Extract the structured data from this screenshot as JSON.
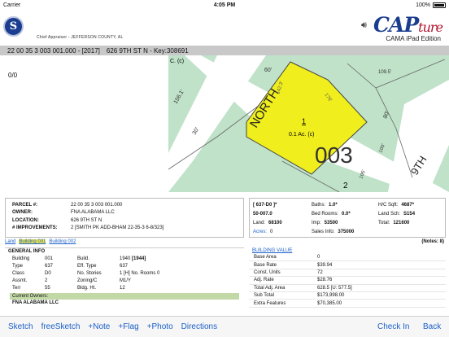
{
  "status": {
    "carrier": "Carrier",
    "time": "4:05 PM",
    "battery": "100%"
  },
  "header": {
    "logo_letter": "S",
    "appraiser": "Chief Appraiser - JEFFERSON COUNTY, AL",
    "brand_main": "CAP",
    "brand_script": "ture",
    "edition": "CAMA iPad Edition"
  },
  "titlebar": {
    "parcel_year": "22 00 35 3 003 001.000 - [2017]",
    "address_key": "626 9TH ST N - Key:308691"
  },
  "nav_count": "0/0",
  "map": {
    "labels": {
      "corner_c": "C. (c)",
      "north": "NORTH",
      "ninth": "9TH",
      "block": "003",
      "lot": "1",
      "acreage": "0.1 Ac. (c)",
      "lot2": "2",
      "d156": "156.1'",
      "d30": "30'",
      "d60": "60'",
      "d142": "142.3'",
      "d176": "176'",
      "d80": "80'",
      "d109": "109.5'",
      "d105": "105'",
      "d100": "100'"
    }
  },
  "parcel": {
    "rows": [
      {
        "key": "PARCEL #:",
        "value": "22 00 35 3 003 001.000"
      },
      {
        "key": "OWNER:",
        "value": "FNA ALABAMA LLC"
      },
      {
        "key": "LOCATION:",
        "value": "626 9TH ST N"
      },
      {
        "key": "# IMPROVEMENTS:",
        "value": "2 [SMITH PK ADD-BHAM 22-35-3 6-8/323]"
      }
    ]
  },
  "values": {
    "code": "[ 637-D0 ]*",
    "baths_label": "Baths:",
    "baths": "1.0*",
    "hc_label": "H/C Sqft:",
    "hc": "4687*",
    "zone": "50-007.0",
    "bed_label": "Bed Rooms:",
    "bed": "0.0*",
    "sch_label": "Land Sch:",
    "sch": "S154",
    "land_label": "Land:",
    "land": "68100",
    "imp_label": "Imp:",
    "imp": "53500",
    "total_label": "Total:",
    "total": "121600",
    "acres_label": "Acres:",
    "acres": "0",
    "sales_label": "Sales Info:",
    "sales": "375000"
  },
  "tabs": {
    "land": "Land",
    "b1": "Building 001",
    "b2": "Building 002",
    "notes": "(Notes: 8)"
  },
  "general": {
    "title": "GENERAL INFO",
    "rows": [
      {
        "a": "Building",
        "b": "001",
        "c": "Build.",
        "d": "1940",
        "e": "[1944]"
      },
      {
        "a": "Type",
        "b": "637",
        "c": "Eff. Type",
        "d": "637",
        "e": ""
      },
      {
        "a": "Class",
        "b": "D0",
        "c": "No. Stories",
        "d": "1 [H] No. Rooms 0",
        "e": ""
      },
      {
        "a": "Assmt.",
        "b": "2",
        "c": "Zoning/C",
        "d": "M1/Y",
        "e": ""
      },
      {
        "a": "Terr",
        "b": "55",
        "c": "Bldg. Ht.",
        "d": "12",
        "e": ""
      }
    ],
    "owners_label": "Current Owners:",
    "owner_name": "FNA ALABAMA LLC"
  },
  "building": {
    "title": "BUILDING VALUE",
    "rows": [
      {
        "l": "Base Area",
        "r": "0"
      },
      {
        "l": "Base Rate",
        "r": "$39.94"
      },
      {
        "l": "Const. Units",
        "r": "72"
      },
      {
        "l": "Adj. Rate",
        "r": "$28.76"
      },
      {
        "l": "Total Adj. Area",
        "r": "628.5 [U: 577.5]"
      },
      {
        "l": "Sub Total",
        "r": "$173,998.00"
      },
      {
        "l": "Extra Features",
        "r": "$70,385.00"
      }
    ]
  },
  "toolbar": {
    "sketch": "Sketch",
    "freesketch": "freeSketch",
    "note": "+Note",
    "flag": "+Flag",
    "photo": "+Photo",
    "directions": "Directions",
    "checkin": "Check In",
    "back": "Back"
  },
  "colors": {
    "accent": "#1a5fc8",
    "parcel_fill": "#f0ee1c",
    "map_bg": "#bfe2c9",
    "owners_bar": "#c2d8a6"
  }
}
